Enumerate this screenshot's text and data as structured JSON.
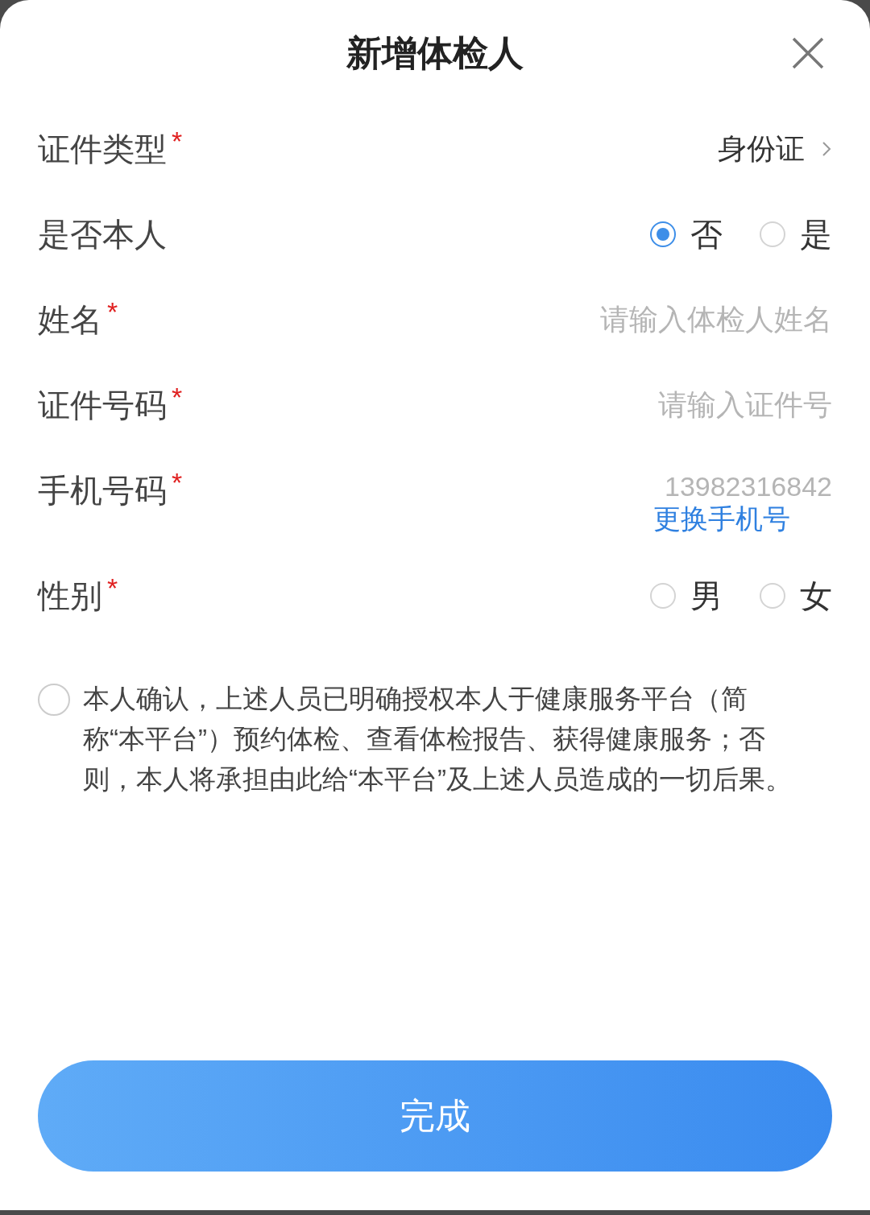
{
  "title": "新增体检人",
  "rows": [
    {
      "kind": "select",
      "label": "证件类型",
      "required_mark": "*",
      "value": "身份证"
    },
    {
      "kind": "radio",
      "label": "是否本人",
      "options": [
        {
          "label": "否",
          "selected": true
        },
        {
          "label": "是",
          "selected": false
        }
      ]
    },
    {
      "kind": "input",
      "label": "姓名",
      "required_mark": "*",
      "placeholder": "请输入体检人姓名"
    },
    {
      "kind": "input",
      "label": "证件号码",
      "required_mark": "*",
      "placeholder": "请输入证件号"
    },
    {
      "kind": "phone",
      "label": "手机号码",
      "required_mark": "*",
      "value": "13982316842",
      "link": "更换手机号"
    },
    {
      "kind": "radio",
      "label": "性别",
      "required_mark": "*",
      "options": [
        {
          "label": "男",
          "selected": false
        },
        {
          "label": "女",
          "selected": false
        }
      ]
    }
  ],
  "consent": {
    "checked": false,
    "text": "本人确认，上述人员已明确授权本人于健康服务平台（简称“本平台”）预约体检、查看体检报告、获得健康服务；否则，本人将承担由此给“本平台”及上述人员造成的一切后果。"
  },
  "submit": "完成"
}
